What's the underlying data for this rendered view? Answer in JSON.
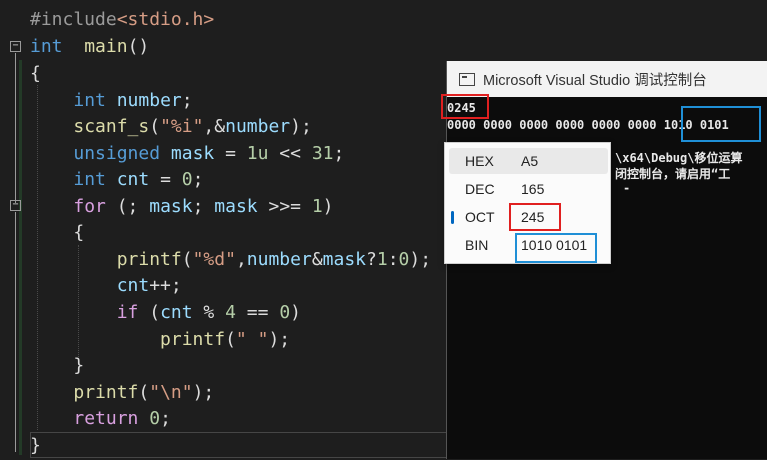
{
  "editor": {
    "lines": [
      {
        "parts": [
          [
            "pp",
            "#include"
          ],
          [
            "inc",
            "<stdio.h>"
          ]
        ]
      },
      {
        "parts": [
          [
            "kw",
            "int"
          ],
          [
            "",
            "  "
          ],
          [
            "fn",
            "main"
          ],
          [
            "",
            "()"
          ]
        ]
      },
      {
        "parts": [
          [
            "",
            "{"
          ]
        ]
      },
      {
        "parts": [
          [
            "",
            "    "
          ],
          [
            "kw",
            "int"
          ],
          [
            "",
            " "
          ],
          [
            "var",
            "number"
          ],
          [
            "",
            ";"
          ]
        ]
      },
      {
        "parts": [
          [
            "",
            "    "
          ],
          [
            "fn",
            "scanf_s"
          ],
          [
            "",
            "("
          ],
          [
            "str",
            "\"%i\""
          ],
          [
            "",
            ",&"
          ],
          [
            "var",
            "number"
          ],
          [
            "",
            ");"
          ]
        ]
      },
      {
        "parts": [
          [
            "",
            "    "
          ],
          [
            "kw",
            "unsigned"
          ],
          [
            "",
            " "
          ],
          [
            "var",
            "mask"
          ],
          [
            "",
            " = "
          ],
          [
            "num",
            "1u"
          ],
          [
            "",
            " << "
          ],
          [
            "num",
            "31"
          ],
          [
            "",
            ";"
          ]
        ]
      },
      {
        "parts": [
          [
            "",
            "    "
          ],
          [
            "kw",
            "int"
          ],
          [
            "",
            " "
          ],
          [
            "var",
            "cnt"
          ],
          [
            "",
            " = "
          ],
          [
            "num",
            "0"
          ],
          [
            "",
            ";"
          ]
        ]
      },
      {
        "parts": [
          [
            "",
            "    "
          ],
          [
            "kw2",
            "for"
          ],
          [
            "",
            " (; "
          ],
          [
            "var",
            "mask"
          ],
          [
            "",
            "; "
          ],
          [
            "var",
            "mask"
          ],
          [
            "",
            " >>= "
          ],
          [
            "num",
            "1"
          ],
          [
            "",
            ")"
          ]
        ]
      },
      {
        "parts": [
          [
            "",
            "    {"
          ]
        ]
      },
      {
        "parts": [
          [
            "",
            "        "
          ],
          [
            "fn",
            "printf"
          ],
          [
            "",
            "("
          ],
          [
            "str",
            "\"%d\""
          ],
          [
            "",
            ","
          ],
          [
            "var",
            "number"
          ],
          [
            "",
            "&"
          ],
          [
            "var",
            "mask"
          ],
          [
            "",
            "?"
          ],
          [
            "num",
            "1"
          ],
          [
            "",
            ":"
          ],
          [
            "num",
            "0"
          ],
          [
            "",
            ");"
          ]
        ]
      },
      {
        "parts": [
          [
            "",
            "        "
          ],
          [
            "var",
            "cnt"
          ],
          [
            "",
            "++;"
          ]
        ]
      },
      {
        "parts": [
          [
            "",
            "        "
          ],
          [
            "kw2",
            "if"
          ],
          [
            "",
            " ("
          ],
          [
            "var",
            "cnt"
          ],
          [
            "",
            " % "
          ],
          [
            "num",
            "4"
          ],
          [
            "",
            " == "
          ],
          [
            "num",
            "0"
          ],
          [
            "",
            ")"
          ]
        ]
      },
      {
        "parts": [
          [
            "",
            "            "
          ],
          [
            "fn",
            "printf"
          ],
          [
            "",
            "("
          ],
          [
            "str",
            "\" \""
          ],
          [
            "",
            ");"
          ]
        ]
      },
      {
        "parts": [
          [
            "",
            "    }"
          ]
        ]
      },
      {
        "parts": [
          [
            "",
            "    "
          ],
          [
            "fn",
            "printf"
          ],
          [
            "",
            "("
          ],
          [
            "str",
            "\"\\n\""
          ],
          [
            "",
            ");"
          ]
        ]
      },
      {
        "parts": [
          [
            "",
            "    "
          ],
          [
            "kw2",
            "return"
          ],
          [
            "",
            " "
          ],
          [
            "num",
            "0"
          ],
          [
            "",
            ";"
          ]
        ]
      },
      {
        "parts": [
          [
            "",
            "}"
          ]
        ]
      }
    ]
  },
  "console": {
    "title": "Microsoft Visual Studio 调试控制台",
    "input_line": "0245",
    "output_line": "0000 0000 0000 0000 0000 0000 1010 0101",
    "path_line": "\\x64\\Debug\\移位运算",
    "hint_line": "闭控制台，请启用“工",
    "cursor": "-"
  },
  "programmer_popup": {
    "rows": [
      {
        "label": "HEX",
        "value": "A5"
      },
      {
        "label": "DEC",
        "value": "165"
      },
      {
        "label": "OCT",
        "value": "245"
      },
      {
        "label": "BIN",
        "value": "1010 0101"
      }
    ]
  },
  "colors": {
    "highlight_red": "#e02020",
    "highlight_blue": "#1f8fd6",
    "selected_indicator": "#0067c0"
  }
}
